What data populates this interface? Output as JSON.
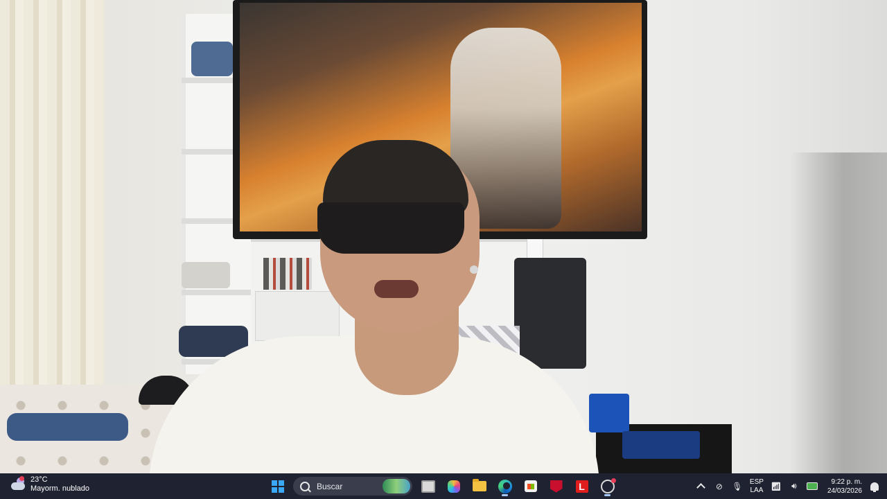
{
  "weather": {
    "temperature": "23°C",
    "condition": "Mayorm. nublado"
  },
  "search": {
    "placeholder": "Buscar"
  },
  "taskbar_apps": [
    {
      "name": "start",
      "icon": "windows-logo-icon"
    },
    {
      "name": "task-view",
      "icon": "task-view-icon"
    },
    {
      "name": "copilot",
      "icon": "copilot-icon"
    },
    {
      "name": "file-explorer",
      "icon": "folder-icon"
    },
    {
      "name": "edge",
      "icon": "edge-icon",
      "active": true
    },
    {
      "name": "store",
      "icon": "store-icon"
    },
    {
      "name": "mcafee",
      "icon": "mcafee-icon"
    },
    {
      "name": "lenovo",
      "icon": "l-icon",
      "label": "L"
    },
    {
      "name": "camera",
      "icon": "camera-ring-icon"
    }
  ],
  "tray": {
    "language_top": "ESP",
    "language_bottom": "LAA",
    "time": "9:22 p. m.",
    "date": "24/03/2026",
    "icons": [
      "chevron-up-icon",
      "location-off-icon",
      "microphone-icon",
      "wifi-icon",
      "volume-icon",
      "battery-icon",
      "notification-bell-icon"
    ]
  },
  "colors": {
    "taskbar_bg": "#1f2230",
    "accent": "#3aa8f4"
  }
}
